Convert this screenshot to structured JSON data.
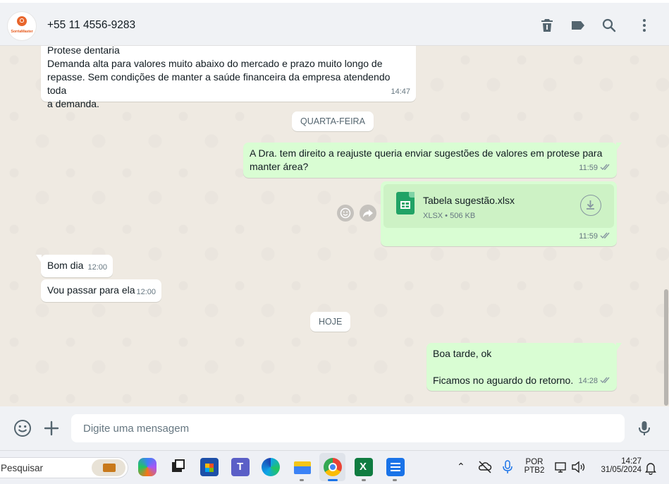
{
  "header": {
    "contact_name": "+55 11 4556-9283",
    "avatar_logo_text": "SorriaMaster",
    "icons": [
      "delete-icon",
      "label-icon",
      "search-icon",
      "menu-icon"
    ]
  },
  "messages": [
    {
      "direction": "in",
      "lines": [
        "Protese dentaria",
        "Demanda alta para valores muito abaixo do mercado e prazo muito longo de",
        "repasse. Sem condições de manter a saúde financeira da empresa atendendo toda",
        "a demanda."
      ],
      "time": "14:47"
    },
    {
      "type": "date",
      "text": "QUARTA-FEIRA"
    },
    {
      "direction": "out",
      "lines": [
        "A Dra. tem direito a reajuste queria enviar sugestões de valores em protese para",
        "manter área?"
      ],
      "time": "11:59",
      "read": true
    },
    {
      "direction": "out",
      "type": "file",
      "file_name": "Tabela sugestão.xlsx",
      "file_meta": "XLSX • 506 KB",
      "time": "11:59",
      "read": true
    },
    {
      "direction": "in",
      "lines": [
        "Bom dia"
      ],
      "time": "12:00"
    },
    {
      "direction": "in",
      "lines": [
        "Vou passar para ela"
      ],
      "time": "12:00"
    },
    {
      "type": "date",
      "text": "HOJE"
    },
    {
      "direction": "out",
      "lines": [
        "Boa tarde, ok",
        "",
        "Ficamos no aguardo do retorno."
      ],
      "time": "14:28",
      "read": true
    }
  ],
  "composer": {
    "placeholder": "Digite uma mensagem"
  },
  "taskbar": {
    "search_placeholder": "Pesquisar",
    "lang_line1": "POR",
    "lang_line2": "PTB2",
    "time": "14:27",
    "date": "31/05/2024",
    "colors": {
      "whatsapp_out": "#d9fdd3",
      "excel_green": "#21a366",
      "brand_orange": "#e8652b"
    }
  }
}
